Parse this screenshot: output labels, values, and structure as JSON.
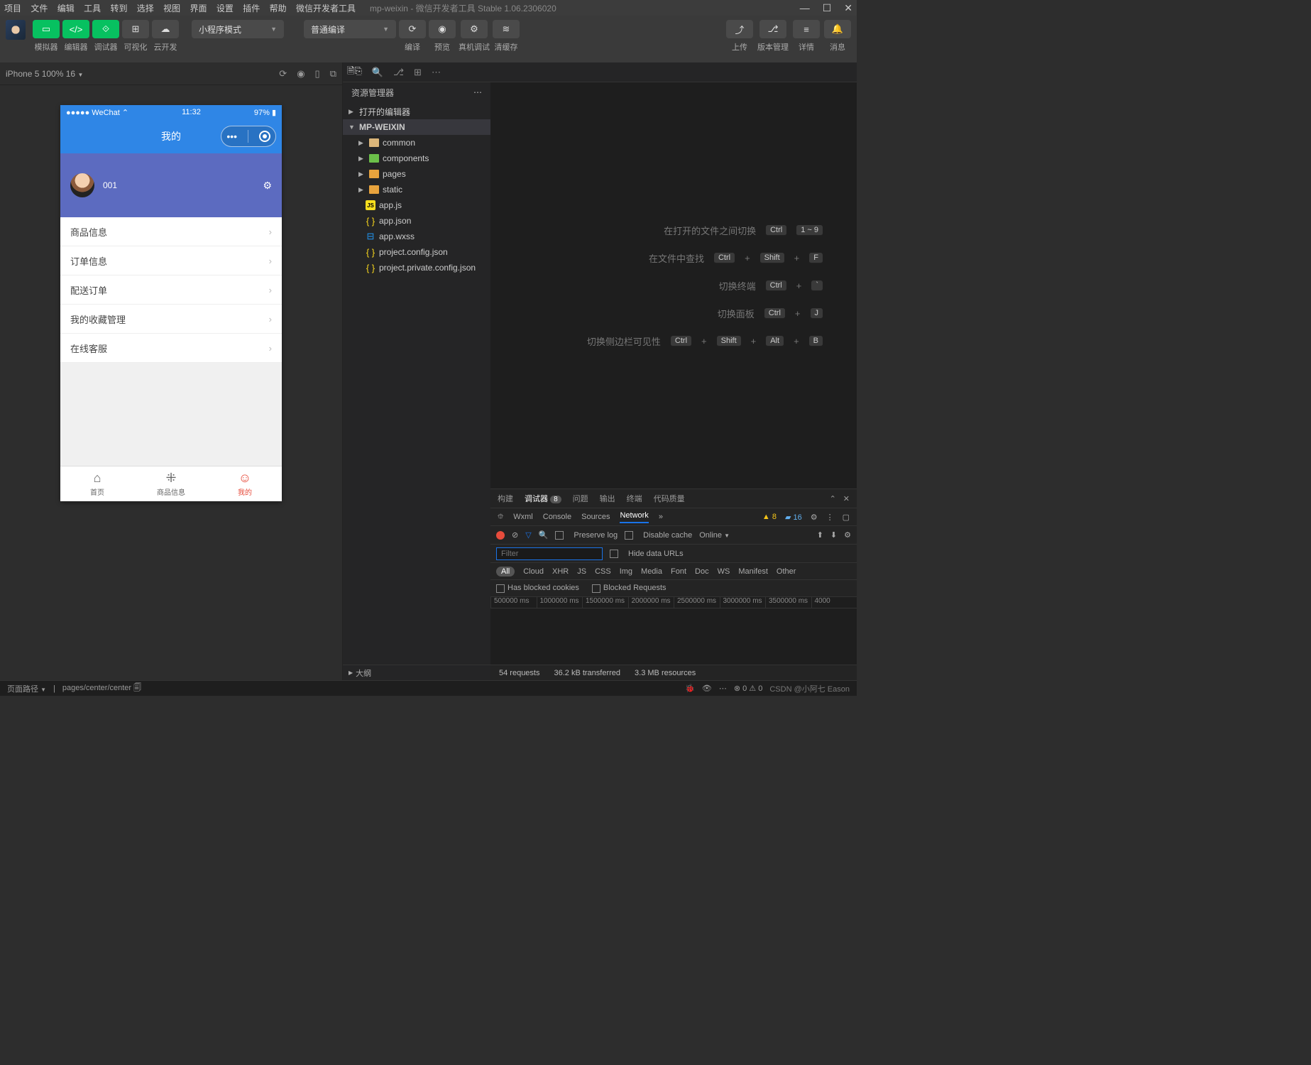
{
  "titlebar": {
    "menus": [
      "项目",
      "文件",
      "编辑",
      "工具",
      "转到",
      "选择",
      "视图",
      "界面",
      "设置",
      "插件",
      "帮助",
      "微信开发者工具"
    ],
    "title": "mp-weixin - 微信开发者工具 Stable 1.06.2306020"
  },
  "toolbar": {
    "left_labels": [
      "模拟器",
      "编辑器",
      "调试器",
      "可视化",
      "云开发"
    ],
    "mode_select": "小程序模式",
    "compile_select": "普通编译",
    "mid_labels": [
      "编译",
      "预览",
      "真机调试",
      "清缓存"
    ],
    "right_labels": [
      "上传",
      "版本管理",
      "详情",
      "消息"
    ]
  },
  "simulator": {
    "device": "iPhone 5 100% 16",
    "status": {
      "carrier": "WeChat",
      "time": "11:32",
      "battery": "97%"
    },
    "nav_title": "我的",
    "profile": {
      "name": "001"
    },
    "menu": [
      "商品信息",
      "订单信息",
      "配送订单",
      "我的收藏管理",
      "在线客服"
    ],
    "tabbar": [
      {
        "label": "首页"
      },
      {
        "label": "商品信息"
      },
      {
        "label": "我的"
      }
    ]
  },
  "explorer": {
    "title": "资源管理器",
    "sections": {
      "open_editors": "打开的编辑器",
      "project": "MP-WEIXIN",
      "outline": "大纲"
    },
    "tree": [
      {
        "name": "common",
        "type": "folder"
      },
      {
        "name": "components",
        "type": "folder-g"
      },
      {
        "name": "pages",
        "type": "folder-o"
      },
      {
        "name": "static",
        "type": "folder-o"
      },
      {
        "name": "app.js",
        "type": "js"
      },
      {
        "name": "app.json",
        "type": "json"
      },
      {
        "name": "app.wxss",
        "type": "wxss"
      },
      {
        "name": "project.config.json",
        "type": "json"
      },
      {
        "name": "project.private.config.json",
        "type": "json"
      }
    ]
  },
  "welcome": [
    {
      "label": "在打开的文件之间切换",
      "keys": [
        "Ctrl",
        "1 ~ 9"
      ]
    },
    {
      "label": "在文件中查找",
      "keys": [
        "Ctrl",
        "+",
        "Shift",
        "+",
        "F"
      ]
    },
    {
      "label": "切换终端",
      "keys": [
        "Ctrl",
        "+",
        "`"
      ]
    },
    {
      "label": "切换面板",
      "keys": [
        "Ctrl",
        "+",
        "J"
      ]
    },
    {
      "label": "切换侧边栏可见性",
      "keys": [
        "Ctrl",
        "+",
        "Shift",
        "+",
        "Alt",
        "+",
        "B"
      ]
    }
  ],
  "devtools": {
    "top_tabs": [
      "构建",
      "调试器",
      "问题",
      "输出",
      "终端",
      "代码质量"
    ],
    "badge": "8",
    "sub_tabs": [
      "Wxml",
      "Console",
      "Sources",
      "Network"
    ],
    "warn_count": "8",
    "info_count": "16",
    "preserve": "Preserve log",
    "disable": "Disable cache",
    "online": "Online",
    "filter_placeholder": "Filter",
    "hide_urls": "Hide data URLs",
    "types": [
      "All",
      "Cloud",
      "XHR",
      "JS",
      "CSS",
      "Img",
      "Media",
      "Font",
      "Doc",
      "WS",
      "Manifest",
      "Other"
    ],
    "blocked1": "Has blocked cookies",
    "blocked2": "Blocked Requests",
    "timeline_ticks": [
      "500000 ms",
      "1000000 ms",
      "1500000 ms",
      "2000000 ms",
      "2500000 ms",
      "3000000 ms",
      "3500000 ms",
      "4000"
    ],
    "status": {
      "requests": "54 requests",
      "transfer": "36.2 kB transferred",
      "resources": "3.3 MB resources"
    }
  },
  "statusbar": {
    "path_label": "页面路径",
    "path": "pages/center/center",
    "err": "0",
    "warn": "0",
    "watermark": "CSDN @小阿七 Eason"
  }
}
